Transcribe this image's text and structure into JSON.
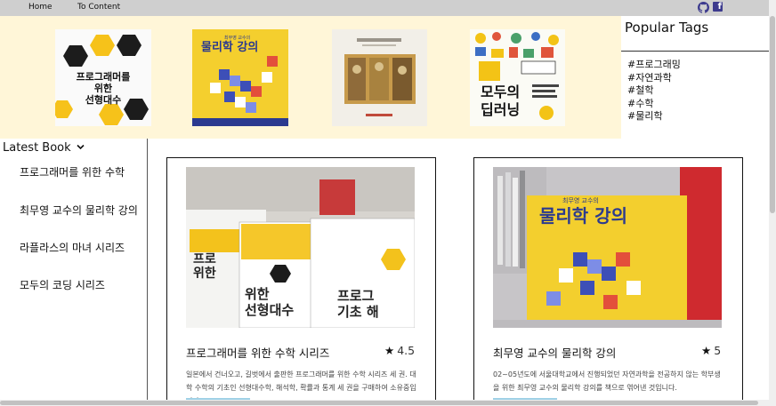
{
  "nav": {
    "home": "Home",
    "content": "To Content",
    "icons": [
      "github-icon",
      "facebook-icon"
    ]
  },
  "banner": {
    "covers": [
      {
        "name": "cover-linear-algebra",
        "text_top": "",
        "text_main": "프로그래머를 위한 선형대수"
      },
      {
        "name": "cover-physics",
        "text_top": "최무영 교수의",
        "text_main": "물리학 강의"
      },
      {
        "name": "cover-art",
        "text_top": "",
        "text_main": ""
      },
      {
        "name": "cover-deep-learning",
        "text_top": "",
        "text_main": "모두의 딥러닝"
      }
    ]
  },
  "tags": {
    "title": "Popular Tags",
    "items": [
      "#프로그래밍",
      "#자연과학",
      "#철학",
      "#수학",
      "#물리학"
    ]
  },
  "sidebar": {
    "title": "Latest Book",
    "items": [
      "프로그래머를 위한 수학",
      "최무영 교수의 물리학 강의",
      "라플라스의 마녀 시리즈",
      "모두의 코딩 시리즈"
    ]
  },
  "cards": [
    {
      "title": "프로그래머를 위한 수학 시리즈",
      "rating": "4.5",
      "desc": "일본에서 건너오고, 길벗에서 출판한 프로그래머를 위한 수학 시리즈 세 권. 대학 수학의 기초인 선형대수학, 해석학, 확률과 통계 세 권을 구매하여 소유중입니다."
    },
    {
      "title": "최무영 교수의 물리학 강의",
      "rating": "5",
      "desc": "02~05년도에 서울대학교에서 진행되었던 자연과학을 전공하지 않는 학부생을 위한 최무영 교수의 물리학 강의를 책으로 엮어낸 것입니다."
    }
  ],
  "colors": {
    "banner_bg": "#fff6d8",
    "nav_bg": "#cfcfcf",
    "accent_yellow": "#f5c518",
    "button_blue": "#9fd1e6"
  }
}
